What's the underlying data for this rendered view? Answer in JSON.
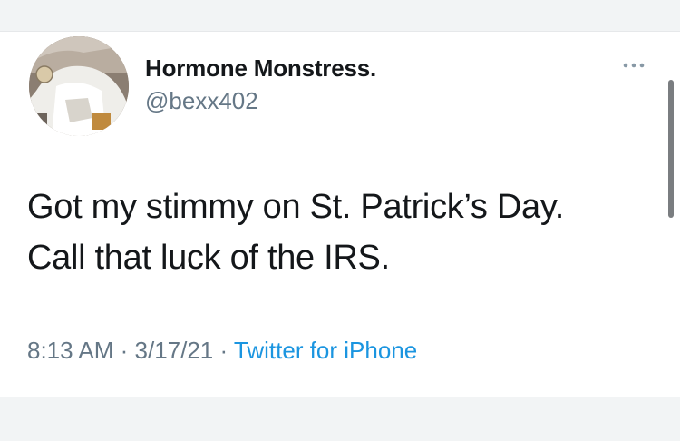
{
  "tweet": {
    "display_name": "Hormone Monstress.",
    "handle": "@bexx402",
    "text_lines": [
      "Got my stimmy on St. Patrick’s Day.",
      "Call that luck of the IRS."
    ],
    "time": "8:13 AM",
    "separator": " · ",
    "date": "3/17/21",
    "source": "Twitter for iPhone"
  },
  "icons": {
    "more": "more-options-icon",
    "avatar": "profile-photo"
  },
  "colors": {
    "text": "#14171a",
    "secondary": "#657786",
    "link": "#1b95e0",
    "background": "#ffffff"
  }
}
